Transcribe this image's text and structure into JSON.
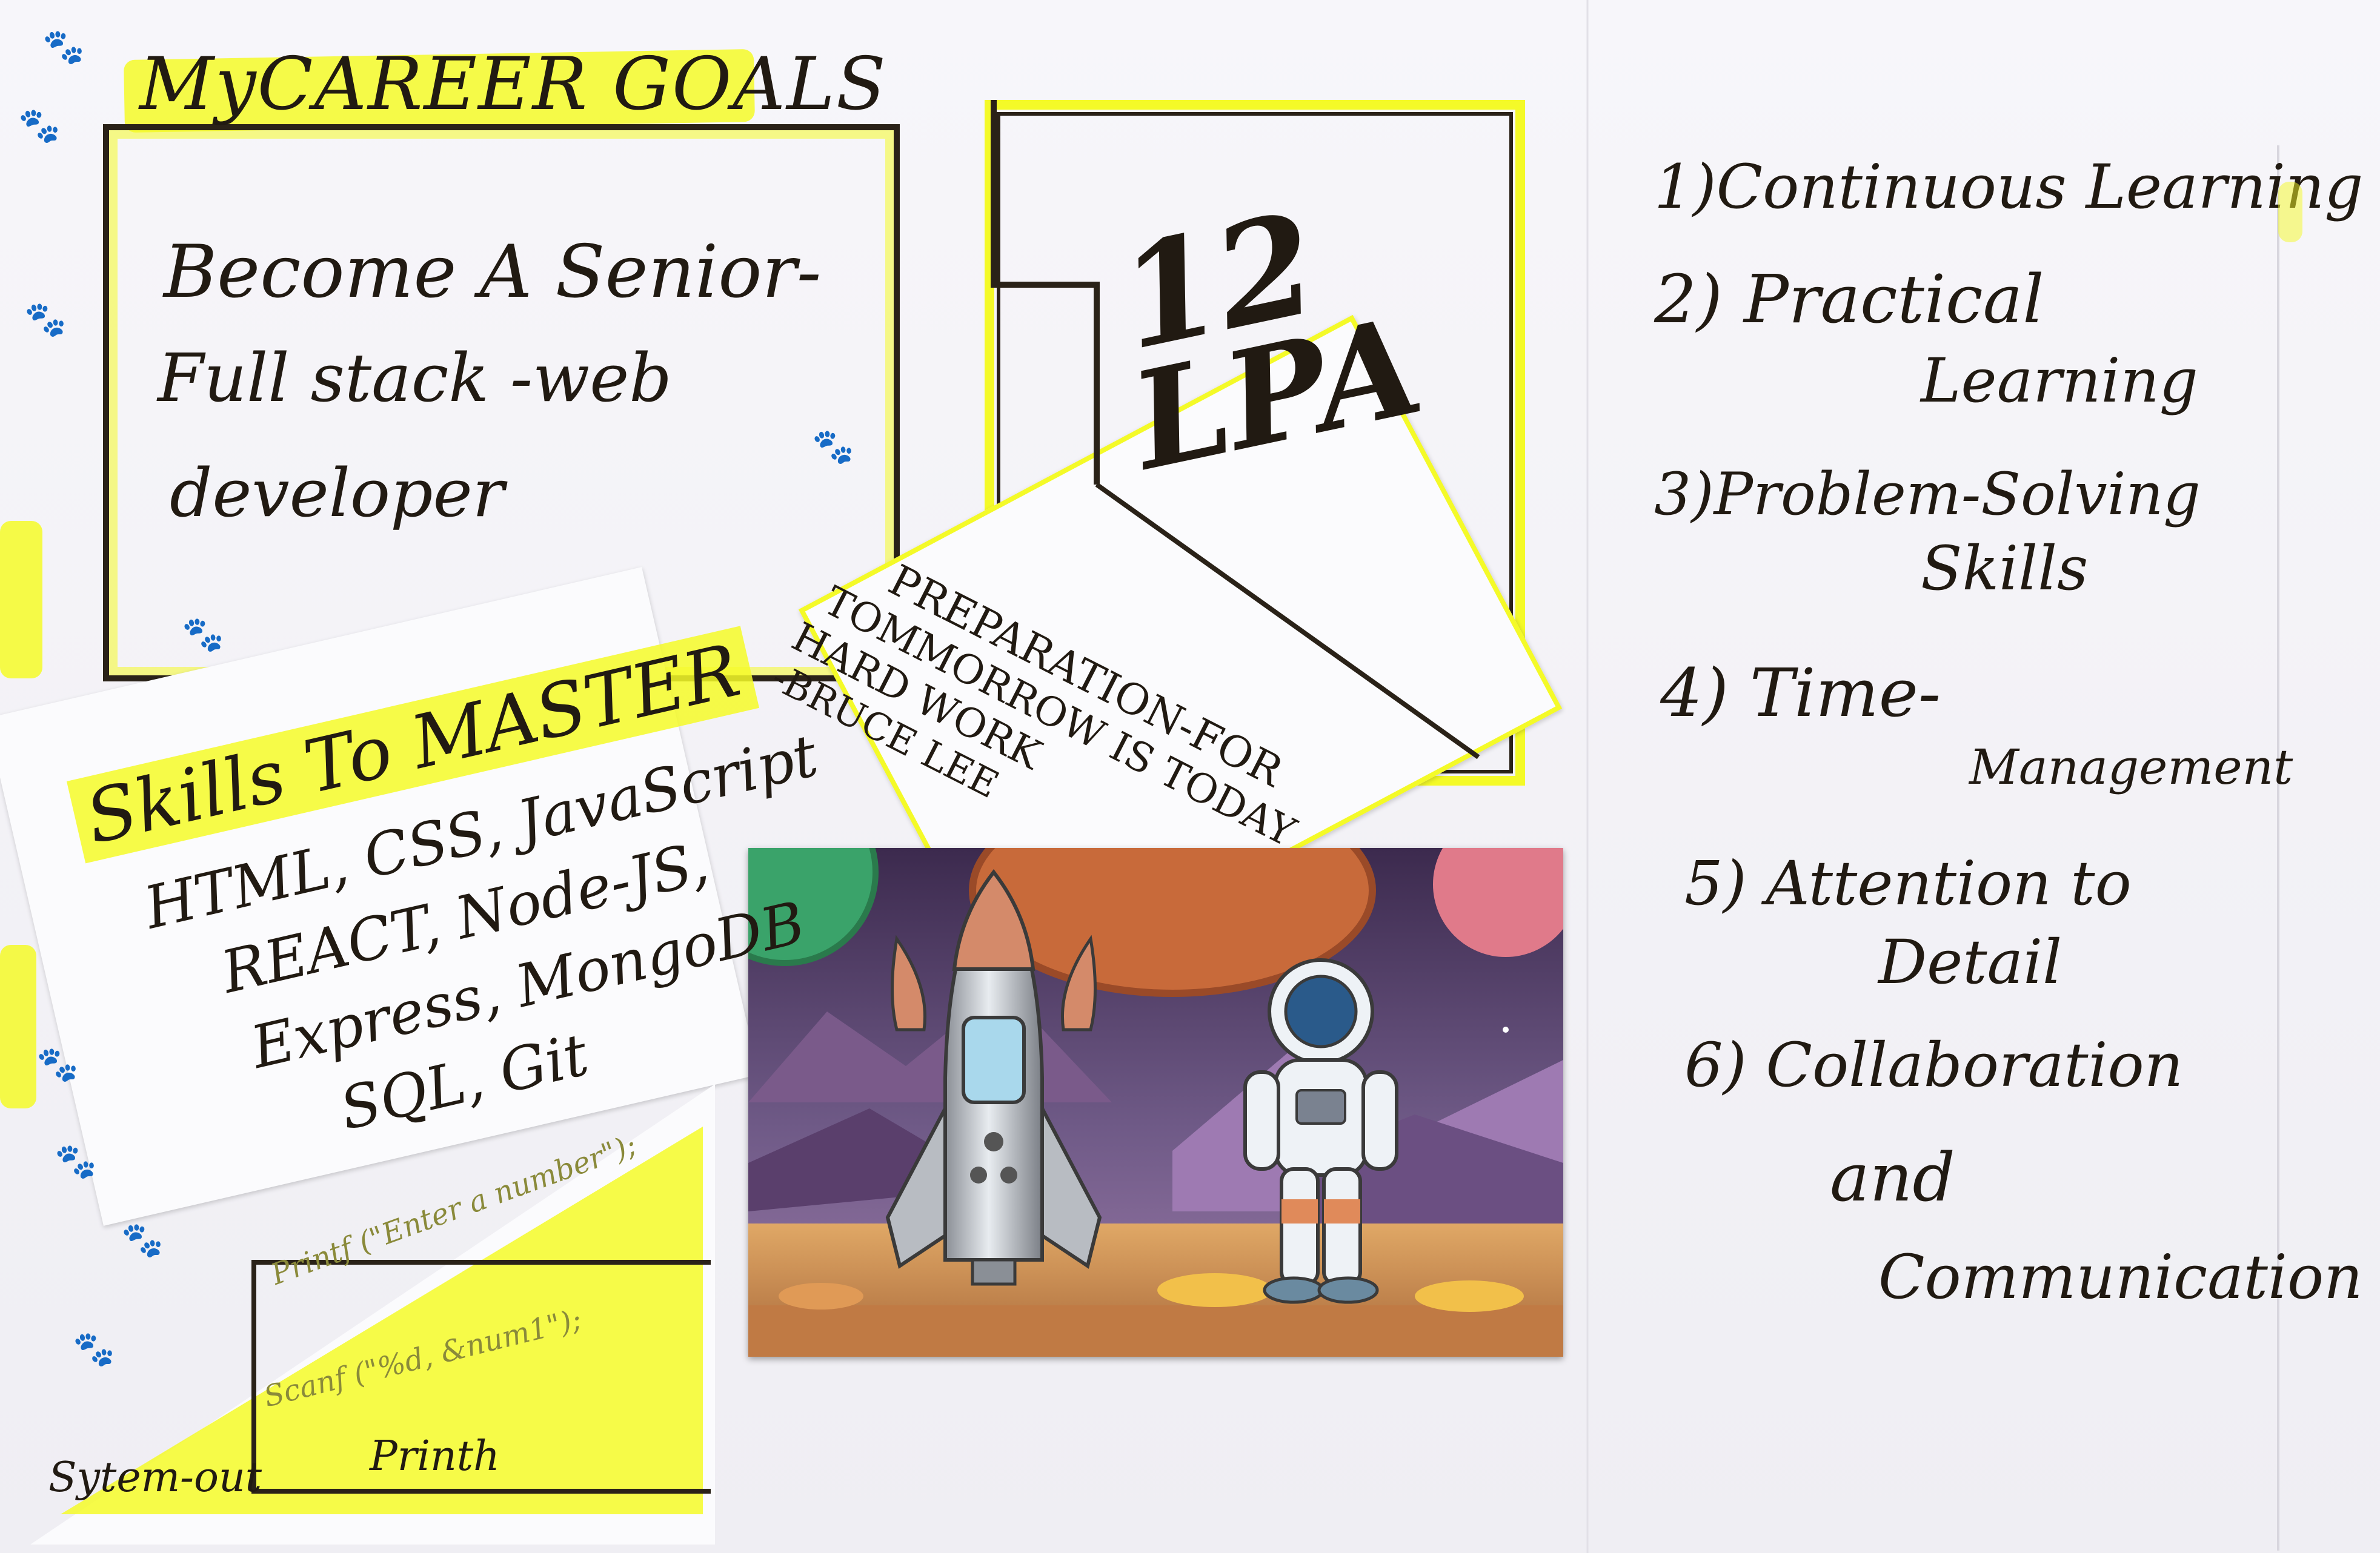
{
  "goals": {
    "heading": "MyCAREER GOALS",
    "line1": "Become A Senior-",
    "line2": "Full stack -web",
    "line3": "developer"
  },
  "salary": {
    "amount": "12",
    "unit": "LPA"
  },
  "quote": {
    "line1": "PREPARATION-FOR",
    "line2": "TOMMORROW IS TODAY",
    "line3": "HARD WORK",
    "author": "-BRUCE LEE"
  },
  "skills": {
    "heading": "Skills To MASTER",
    "row1": "HTML, CSS, JavaScript",
    "row2": "REACT, Node-JS,",
    "row3": "Express, MongoDB",
    "row4": "SQL, Git"
  },
  "code": {
    "line1": "Printf (\"Enter a number\");",
    "line2": "Scanf (\"%d, &num1\");",
    "label1": "Sytem-out",
    "label2": "Printh"
  },
  "learning": {
    "item1": "1)Continuous Learning",
    "item2a": "2) Practical",
    "item2b": "Learning",
    "item3a": "3)Problem-Solving",
    "item3b": "Skills",
    "item4a": "4) Time-",
    "item4b": "Management",
    "item5a": "5) Attention to",
    "item5b": "Detail",
    "item6a": "6) Collaboration",
    "item6b": "and",
    "item6c": "Communication"
  },
  "colors": {
    "highlighter": "#f4fa28",
    "ink": "#211a12",
    "paper": "#fbfbfd"
  }
}
